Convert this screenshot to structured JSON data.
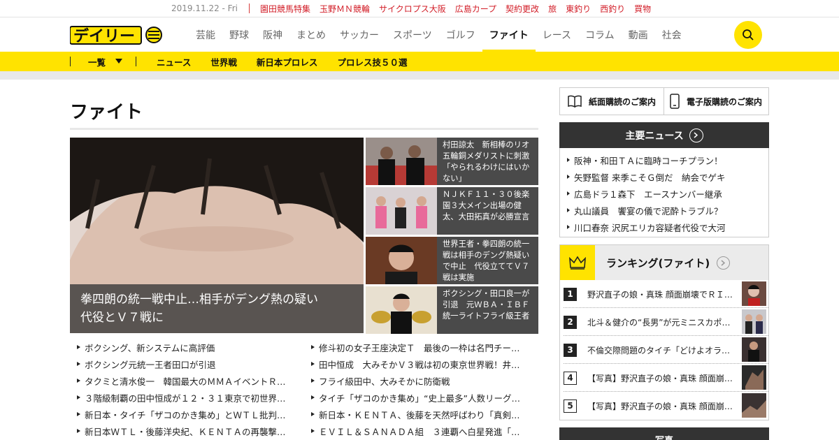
{
  "top_bar": {
    "date": "2019.11.22 - Fri",
    "links": [
      "園田競馬特集",
      "玉野ＭＮ競輪",
      "サイクロプス大阪",
      "広島カープ",
      "契約更改",
      "旅",
      "東釣り",
      "西釣り",
      "買物"
    ]
  },
  "header": {
    "logo_text": "デイリー",
    "nav": [
      "芸能",
      "野球",
      "阪神",
      "まとめ",
      "サッカー",
      "スポーツ",
      "ゴルフ",
      "ファイト",
      "レース",
      "コラム",
      "動画",
      "社会"
    ],
    "active_nav": "ファイト"
  },
  "subnav": {
    "dropdown_label": "一覧",
    "items": [
      "ニュース",
      "世界戦",
      "新日本プロレス",
      "プロレス技５０選"
    ]
  },
  "main": {
    "page_title": "ファイト",
    "hero_caption": "拳四朗の統一戦中止…相手がデング熱の疑い\n代役とＶ７戦に",
    "side_articles": [
      {
        "text": "村田諒太　新相棒のリオ五輪銅メダリストに刺激「やられるわけにはいかない」"
      },
      {
        "text": "ＮＪＫＦ１１・３０後楽園３大メイン出場の健太、大田拓真が必勝宣言"
      },
      {
        "text": "世界王者・拳四朗の統一戦は相手のデング熱疑いで中止　代役立ててＶ７戦は実施"
      },
      {
        "text": "ボクシング・田口良一が引退　元ＷＢＡ・ＩＢＦ統一ライトフライ級王者"
      }
    ],
    "list_left": [
      "ボクシング、新システムに高評価",
      "ボクシング元統一王者田口が引退",
      "タクミと清水俊一　韓国最大のＭＭＡイベントＲ…",
      "３階級制覇の田中恒成が１２・３１東京で初世界…",
      "新日本・タイチ「ザコのかき集め」とＷＴＬ批判…",
      "新日本ＷＴＬ・後藤洋央紀、ＫＥＮＴＡの再襲撃…"
    ],
    "list_right": [
      "修斗初の女子王座決定Ｔ　最後の一枠は名門チー…",
      "田中恒成　大みそかＶ３戦は初の東京世界戦！井…",
      "フライ級田中、大みそかに防衛戦",
      "タイチ「ザコのかき集め」“史上最多”人数リーグ…",
      "新日本・ＫＥＮＴＡ、後藤を天然呼ばわり「真剣…",
      "ＥＶＩＬ＆ＳＡＮＡＤＡ組　３連覇へ白星発進「…"
    ]
  },
  "sidebar": {
    "paper_subscription": "紙面購読のご案内",
    "digital_subscription": "電子版購読のご案内",
    "main_news_title": "主要ニュース",
    "main_news": [
      "阪神・和田ＴＡに臨時コーチプラン！",
      "矢野監督 来季こそＧ倒だ　納会でゲキ",
      "広島ドラ１森下　エースナンバー継承",
      "丸山議員　饗宴の儀で泥酔トラブル？",
      "川口春奈 沢尻エリカ容疑者代役で大河"
    ],
    "ranking_title": "ランキング(ファイト)",
    "ranking": [
      {
        "rank": "1",
        "text": "野沢直子の娘・真珠 顔面崩壊でＲＩ…"
      },
      {
        "rank": "2",
        "text": "北斗＆健介の“長男”が元ミニスカポリ…"
      },
      {
        "rank": "3",
        "text": "不倫交際問題のタイチ「どけよオラ！」"
      },
      {
        "rank": "4",
        "text": "【写真】野沢直子の娘・真珠 顔面崩…"
      },
      {
        "rank": "5",
        "text": "【写真】野沢直子の娘・真珠 顔面崩…"
      }
    ],
    "photo_title": "写真"
  }
}
